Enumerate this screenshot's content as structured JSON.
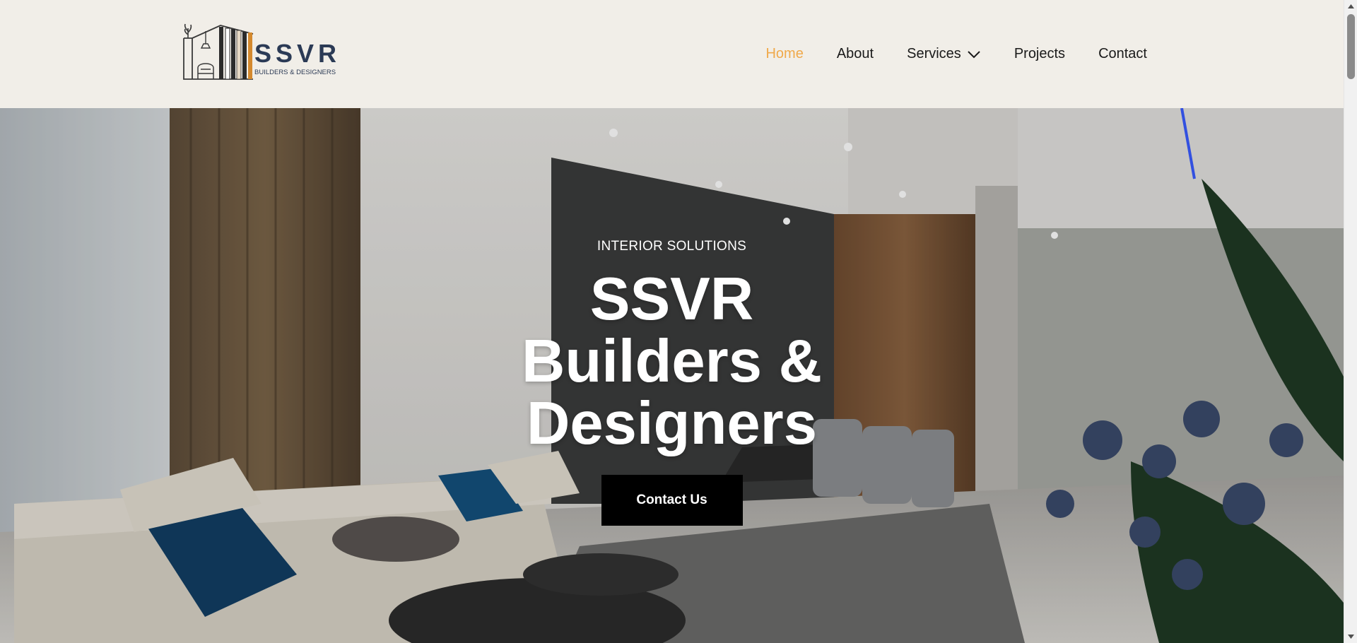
{
  "brand": {
    "name": "SSVR",
    "tagline": "BUILDERS & DESIGNERS"
  },
  "nav": {
    "items": [
      {
        "label": "Home",
        "active": true
      },
      {
        "label": "About"
      },
      {
        "label": "Services",
        "has_dropdown": true
      },
      {
        "label": "Projects"
      },
      {
        "label": "Contact"
      }
    ]
  },
  "hero": {
    "eyebrow": "INTERIOR SOLUTIONS",
    "title": "SSVR Builders & Designers",
    "cta_label": "Contact Us"
  },
  "colors": {
    "header_bg": "#f1eee8",
    "accent": "#f0a94a",
    "brand_navy": "#2b3a55",
    "cta_bg": "#000000"
  },
  "icons": {
    "dropdown": "chevron-down-icon",
    "logo_mark": "building-logo-icon"
  }
}
